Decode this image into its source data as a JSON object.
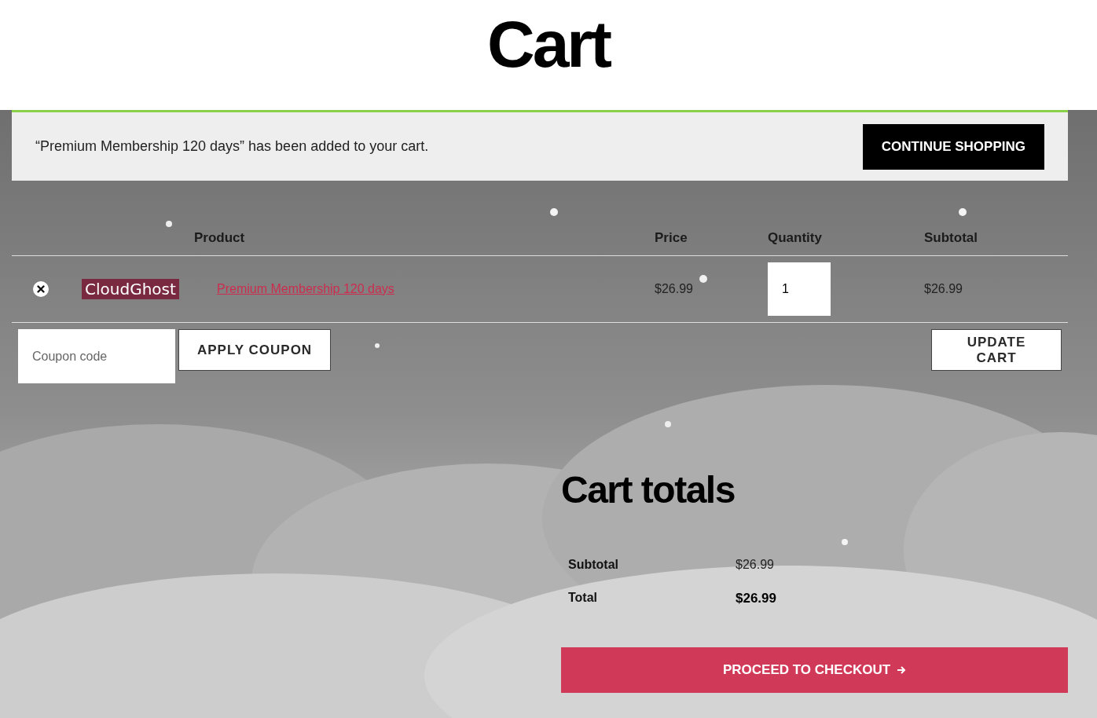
{
  "page_title": "Cart",
  "notice": {
    "message": "“Premium Membership 120 days” has been added to your cart.",
    "button": "CONTINUE SHOPPING"
  },
  "table": {
    "columns": [
      "Product",
      "Price",
      "Quantity",
      "Subtotal"
    ],
    "rows": [
      {
        "thumbnail_text": "CloudGhost",
        "product": "Premium Membership 120 days",
        "price": "$26.99",
        "quantity": "1",
        "subtotal": "$26.99"
      }
    ]
  },
  "coupon": {
    "placeholder": "Coupon code",
    "button": "APPLY COUPON"
  },
  "update_button": "UPDATE CART",
  "totals": {
    "title": "Cart totals",
    "rows": [
      {
        "label": "Subtotal",
        "value": "$26.99",
        "kind": "subtotal"
      },
      {
        "label": "Total",
        "value": "$26.99",
        "kind": "total"
      }
    ],
    "checkout_button": "PROCEED TO CHECKOUT"
  }
}
